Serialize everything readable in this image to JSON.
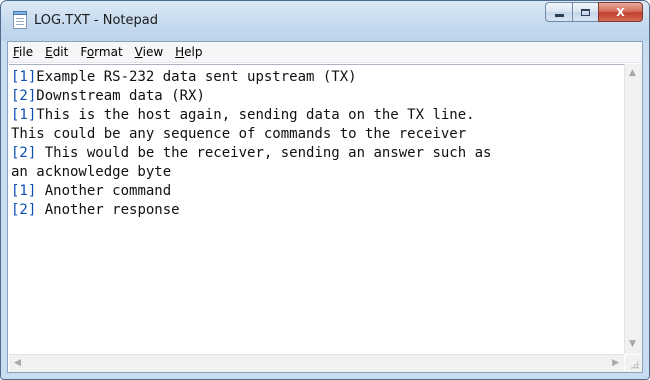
{
  "window": {
    "title": "LOG.TXT - Notepad",
    "icon": "notepad-icon",
    "buttons": {
      "minimize": "minimize-icon",
      "maximize": "maximize-icon",
      "close": "X"
    }
  },
  "menu": {
    "items": [
      {
        "first": "F",
        "rest": "ile"
      },
      {
        "first": "E",
        "rest": "dit"
      },
      {
        "pre": "F",
        "first": "o",
        "rest": "rmat"
      },
      {
        "first": "V",
        "rest": "iew"
      },
      {
        "first": "H",
        "rest": "elp"
      }
    ]
  },
  "document": {
    "lines": [
      {
        "tag": "[1]",
        "text": "Example RS-232 data sent upstream (TX)"
      },
      {
        "tag": "[2]",
        "text": "Downstream data (RX)"
      },
      {
        "tag": "[1]",
        "text": "This is the host again, sending data on the TX line."
      },
      {
        "tag": "",
        "text": "This could be any sequence of commands to the receiver"
      },
      {
        "tag": "[2]",
        "text": " This would be the receiver, sending an answer such as"
      },
      {
        "tag": "",
        "text": "an acknowledge byte"
      },
      {
        "tag": "[1]",
        "text": " Another command"
      },
      {
        "tag": "[2]",
        "text": " Another response"
      }
    ]
  },
  "scrollbars": {
    "up": "▲",
    "down": "▼",
    "left": "◀",
    "right": "▶"
  },
  "colors": {
    "tag": "#0b4fb4",
    "titlebar": "#c9dcf0",
    "close_button": "#c0412d"
  }
}
